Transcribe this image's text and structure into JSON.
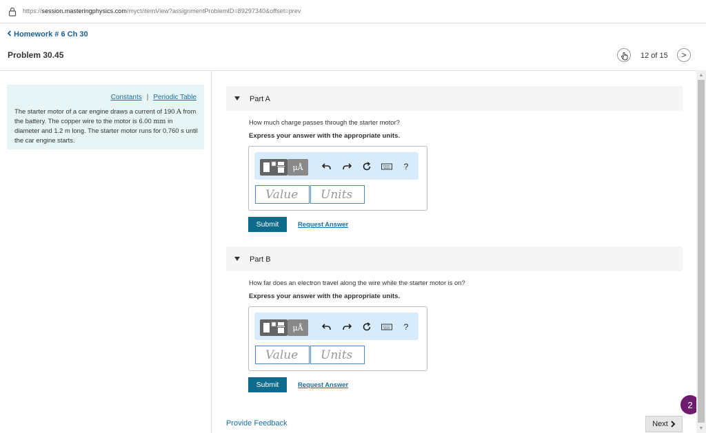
{
  "browser": {
    "url_prefix": "https://",
    "url_domain": "session.masteringphysics.com",
    "url_path": "/myct/itemView?assignmentProblemID=89297340&offset=prev"
  },
  "header": {
    "back_label": "Homework # 6 Ch 30",
    "problem_title": "Problem 30.45",
    "nav_count": "12 of 15",
    "next_chevron": ">"
  },
  "info": {
    "constants_link": "Constants",
    "separator": "|",
    "periodic_link": "Periodic Table",
    "text_1": "The starter motor of a car engine draws a current of 190 ",
    "unit_A": "A",
    "text_2": " from the battery. The copper wire to the motor is 6.00 ",
    "unit_mm": "mm",
    "text_3": " in diameter and 1.2 m long. The starter motor runs for 0.760 ",
    "unit_s": "s",
    "text_4": " until the car engine starts."
  },
  "parts": [
    {
      "label": "Part A",
      "question": "How much charge passes through the starter motor?",
      "express": "Express your answer with the appropriate units.",
      "value_placeholder": "Value",
      "units_placeholder": "Units",
      "submit": "Submit",
      "request": "Request Answer"
    },
    {
      "label": "Part B",
      "question": "How far does an electron travel along the wire while the starter motor is on?",
      "express": "Express your answer with the appropriate units.",
      "value_placeholder": "Value",
      "units_placeholder": "Units",
      "submit": "Submit",
      "request": "Request Answer"
    }
  ],
  "toolbar": {
    "units_label": "μÅ",
    "help_label": "?",
    "icons": [
      "templates-icon",
      "units-icon",
      "undo-icon",
      "redo-icon",
      "reset-icon",
      "keyboard-icon",
      "help-icon"
    ]
  },
  "footer": {
    "feedback": "Provide Feedback",
    "next": "Next",
    "badge": "2"
  },
  "colors": {
    "link": "#1a6ea0",
    "submit_bg": "#0f6b8c",
    "info_bg": "#e6f4f6",
    "toolbar_bg": "#d8ebfa",
    "badge_bg": "#6d1c6f"
  }
}
